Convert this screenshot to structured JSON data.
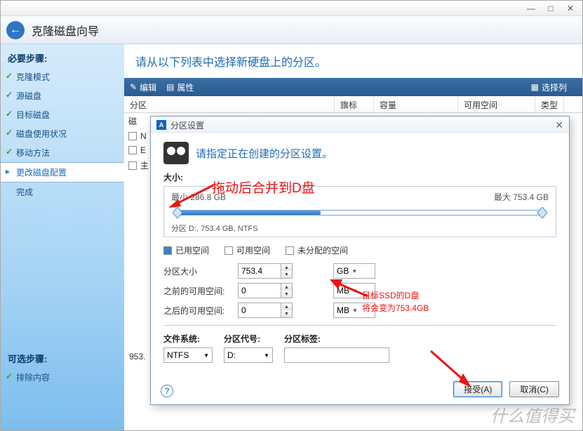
{
  "header": {
    "title": "克隆磁盘向导"
  },
  "sidebar": {
    "required_label": "必要步骤:",
    "optional_label": "可选步骤:",
    "items": [
      {
        "label": "克隆模式"
      },
      {
        "label": "源磁盘"
      },
      {
        "label": "目标磁盘"
      },
      {
        "label": "磁盘使用状况"
      },
      {
        "label": "移动方法"
      },
      {
        "label": "更改磁盘配置"
      },
      {
        "label": "完成"
      }
    ],
    "optional": [
      {
        "label": "排除内容"
      }
    ]
  },
  "main": {
    "instruction": "请从以下列表中选择新硬盘上的分区。",
    "toolbar": {
      "edit": "编辑",
      "props": "属性",
      "select_col": "选择列"
    },
    "cols": {
      "partition": "分区",
      "flag": "旗标",
      "capacity": "容量",
      "free": "可用空间",
      "type": "类型"
    },
    "rows": {
      "disk": "磁",
      "n": "N",
      "e": "E",
      "main_label": "主"
    },
    "disk_size": "953."
  },
  "dialog": {
    "title": "分区设置",
    "subtitle": "请指定正在创建的分区设置。",
    "size_label": "大小:",
    "min_label": "最小 286.8 GB",
    "max_label": "最大 753.4 GB",
    "partition_info": "分区 D:, 753.4 GB, NTFS",
    "legend": {
      "used": "已用空间",
      "free": "可用空间",
      "unalloc": "未分配的空间"
    },
    "fields": {
      "size_label": "分区大小",
      "size_val": "753.4",
      "size_unit": "GB",
      "before_label": "之前的可用空间:",
      "before_val": "0",
      "before_unit": "MB",
      "after_label": "之后的可用空间:",
      "after_val": "0",
      "after_unit": "MB"
    },
    "bottom": {
      "fs_label": "文件系统:",
      "fs_val": "NTFS",
      "letter_label": "分区代号:",
      "letter_val": "D:",
      "vol_label": "分区标签:",
      "vol_val": ""
    },
    "buttons": {
      "accept": "接受(A)",
      "cancel": "取消(C)"
    }
  },
  "annotations": {
    "a1": "拖动后合并到D盘",
    "a2_l1": "目标SSD的D盘",
    "a2_l2": "将会变为753.4GB"
  },
  "watermark": "什么值得买"
}
